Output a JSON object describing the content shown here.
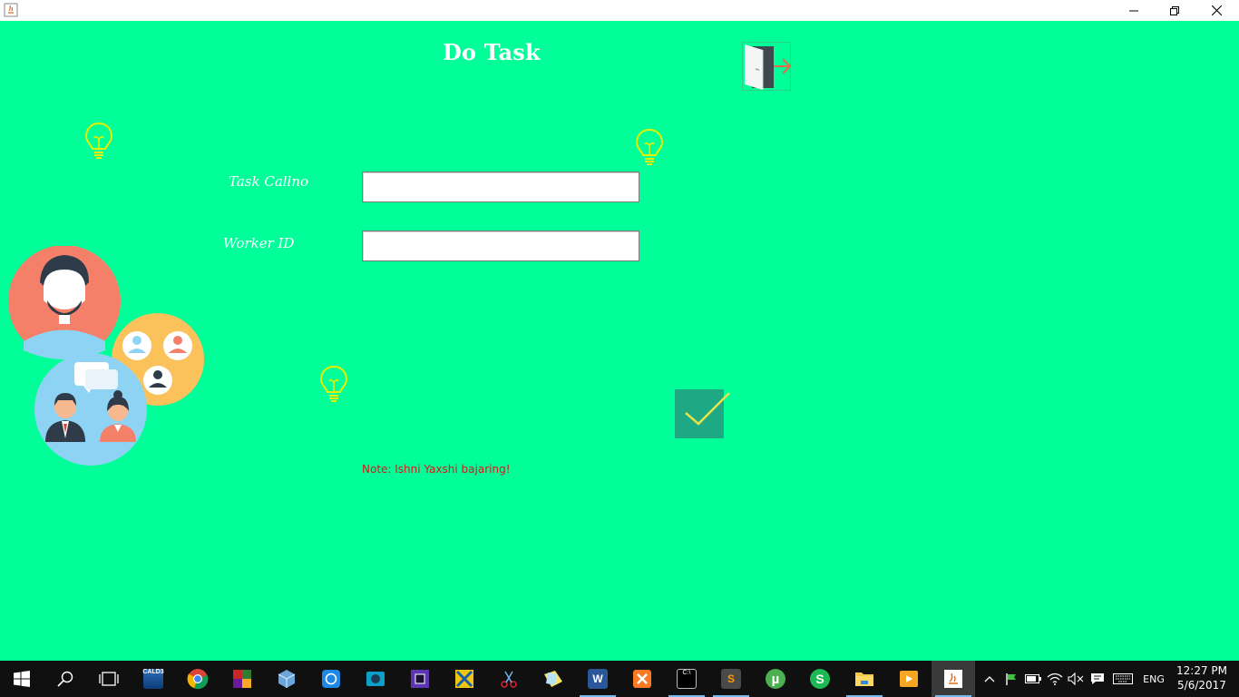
{
  "window": {
    "title": "",
    "controls": {
      "minimize": "minimize-icon",
      "maximize": "restore-icon",
      "close": "close-icon"
    }
  },
  "form": {
    "title": "Do Task",
    "fields": [
      {
        "label": "Task Callno",
        "value": "",
        "placeholder": ""
      },
      {
        "label": "Worker ID",
        "value": "",
        "placeholder": ""
      }
    ],
    "note": "Note: Ishni Yaxshi bajaring!",
    "icons": [
      "exit-door-icon",
      "lightbulb-icon",
      "people-illustration",
      "checkmark-icon"
    ]
  },
  "colors": {
    "background": "#00ff99",
    "title_text": "#ffffff",
    "note_text": "#d11a1a",
    "confirm_button": "#1fa884",
    "taskbar": "#101010"
  },
  "taskbar": {
    "apps": [
      {
        "name": "start-icon",
        "label": ""
      },
      {
        "name": "search-icon",
        "label": ""
      },
      {
        "name": "task-view-icon",
        "label": ""
      },
      {
        "name": "calculator-app-icon",
        "label": "CALD3"
      },
      {
        "name": "chrome-icon",
        "label": ""
      },
      {
        "name": "winrar-icon",
        "label": ""
      },
      {
        "name": "virtualbox-icon",
        "label": ""
      },
      {
        "name": "sync-app-icon",
        "label": ""
      },
      {
        "name": "camera-app-icon",
        "label": ""
      },
      {
        "name": "chip-app-icon",
        "label": ""
      },
      {
        "name": "netbeans-icon",
        "label": ""
      },
      {
        "name": "snipping-tool-icon",
        "label": ""
      },
      {
        "name": "sticky-notes-icon",
        "label": ""
      },
      {
        "name": "word-icon",
        "label": "W"
      },
      {
        "name": "xampp-icon",
        "label": ""
      },
      {
        "name": "cmd-icon",
        "label": "C:\\"
      },
      {
        "name": "sublime-text-icon",
        "label": "S"
      },
      {
        "name": "utorrent-icon",
        "label": "µ"
      },
      {
        "name": "s-app-icon",
        "label": "S"
      },
      {
        "name": "file-explorer-icon",
        "label": ""
      },
      {
        "name": "media-player-icon",
        "label": ""
      },
      {
        "name": "java-icon",
        "label": ""
      }
    ],
    "tray": {
      "language": "ENG",
      "time": "12:27 PM",
      "date": "5/6/2017"
    }
  }
}
